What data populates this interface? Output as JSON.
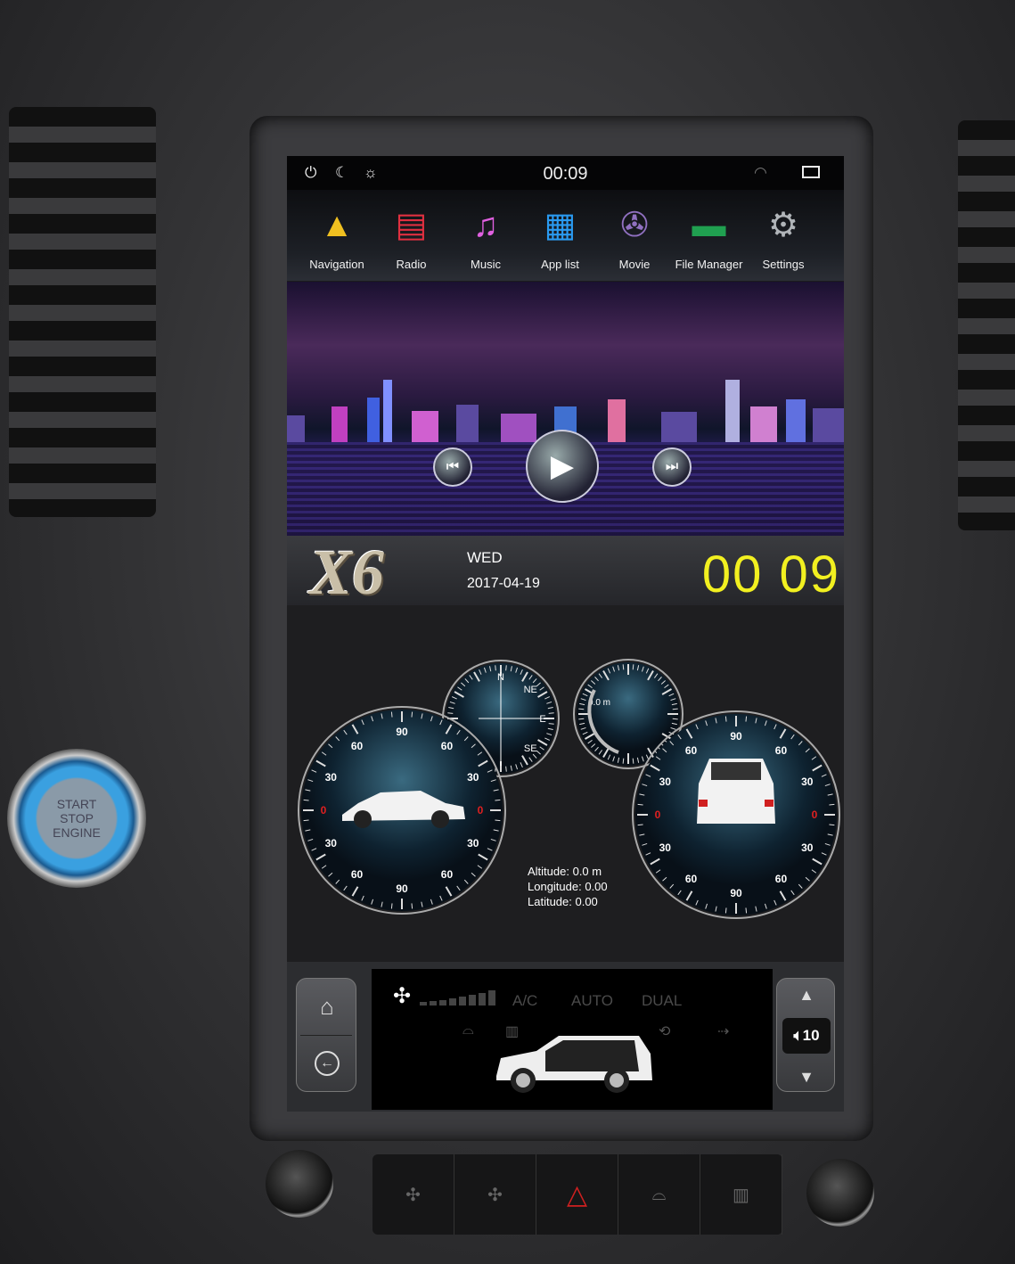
{
  "status_bar": {
    "time": "00:09",
    "icons": [
      "power-icon",
      "night-mode-icon",
      "brightness-icon",
      "wifi-icon",
      "recent-apps-icon"
    ]
  },
  "apps": [
    {
      "label": "Navigation",
      "icon": "navigation-icon"
    },
    {
      "label": "Radio",
      "icon": "radio-icon"
    },
    {
      "label": "Music",
      "icon": "music-icon"
    },
    {
      "label": "App list",
      "icon": "app-list-icon"
    },
    {
      "label": "Movie",
      "icon": "movie-icon"
    },
    {
      "label": "File Manager",
      "icon": "folder-icon"
    },
    {
      "label": "Settings",
      "icon": "gear-icon"
    }
  ],
  "media": {
    "controls": [
      "previous",
      "play",
      "next"
    ]
  },
  "clock_widget": {
    "logo": "X6",
    "day": "WED",
    "date": "2017-04-19",
    "time": "00 09"
  },
  "gauges": {
    "roll_labels": [
      "90",
      "60",
      "60",
      "30",
      "30",
      "0",
      "0",
      "30",
      "30",
      "60",
      "60",
      "90"
    ],
    "compass_labels": [
      "N",
      "NE",
      "E",
      "SE"
    ],
    "altitude_gauge": "0.0 m",
    "altitude": "Altitude: 0.0 m",
    "longitude": "Longitude: 0.00",
    "latitude": "Latitude: 0.00"
  },
  "climate": {
    "ac": "A/C",
    "auto": "AUTO",
    "dual": "DUAL",
    "fan_level": 0
  },
  "volume": {
    "value": "10"
  },
  "hardware": {
    "start_button": "START STOP ENGINE"
  },
  "colors": {
    "clock": "#f2f020",
    "zero_tick": "#e02020",
    "background": "#1e1e20"
  }
}
